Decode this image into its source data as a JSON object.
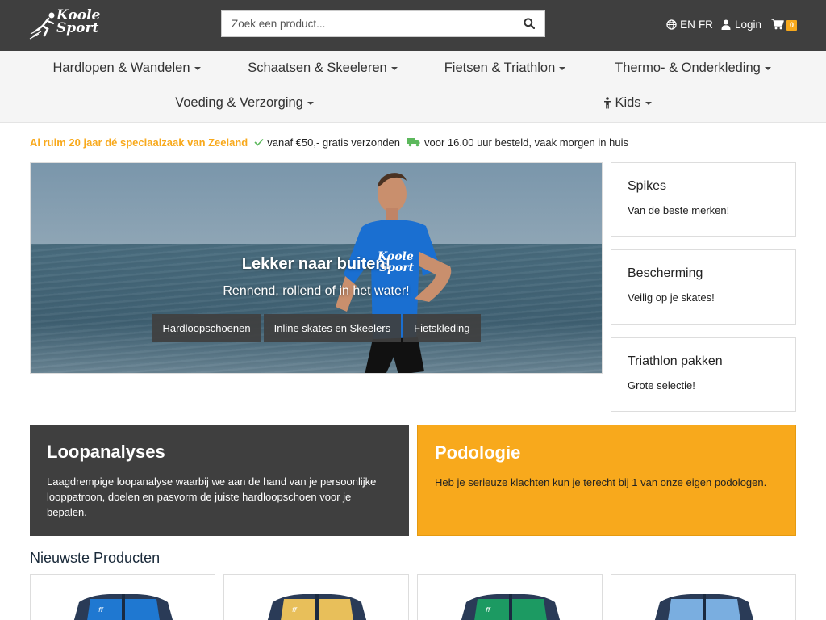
{
  "header": {
    "logo_line1": "Koole",
    "logo_line2": "Sport",
    "search_placeholder": "Zoek een product...",
    "lang_en": "EN",
    "lang_fr": "FR",
    "login_label": "Login",
    "cart_count": "0"
  },
  "nav": {
    "items": [
      {
        "label": "Hardlopen & Wandelen"
      },
      {
        "label": "Schaatsen & Skeeleren"
      },
      {
        "label": "Fietsen & Triathlon"
      },
      {
        "label": "Thermo- & Onderkleding"
      },
      {
        "label": "Voeding & Verzorging"
      },
      {
        "label": "Kids"
      }
    ]
  },
  "usp": {
    "brand": "Al ruim 20 jaar dé speciaalzaak van Zeeland",
    "shipping": "vanaf €50,- gratis verzonden",
    "delivery": "voor 16.00 uur besteld, vaak morgen in huis"
  },
  "hero": {
    "title": "Lekker naar buiten!",
    "subtitle": "Rennend, rollend of in het water!",
    "buttons": [
      "Hardloopschoenen",
      "Inline skates en Skeelers",
      "Fietskleding"
    ]
  },
  "side_cards": [
    {
      "title": "Spikes",
      "text": "Van de beste merken!"
    },
    {
      "title": "Bescherming",
      "text": "Veilig op je skates!"
    },
    {
      "title": "Triathlon pakken",
      "text": "Grote selectie!"
    }
  ],
  "promos": [
    {
      "title": "Loopanalyses",
      "text": "Laagdrempige loopanalyse waarbij we aan de hand van je persoonlijke looppatroon, doelen en pasvorm de juiste hardloopschoen voor je bepalen."
    },
    {
      "title": "Podologie",
      "text": "Heb je serieuze klachten kun je terecht bij 1 van onze eigen podologen."
    }
  ],
  "newest": {
    "title": "Nieuwste Producten"
  },
  "colors": {
    "accent": "#f8a91c",
    "dark": "#3f3f3f",
    "usp_green": "#5cb85c"
  }
}
